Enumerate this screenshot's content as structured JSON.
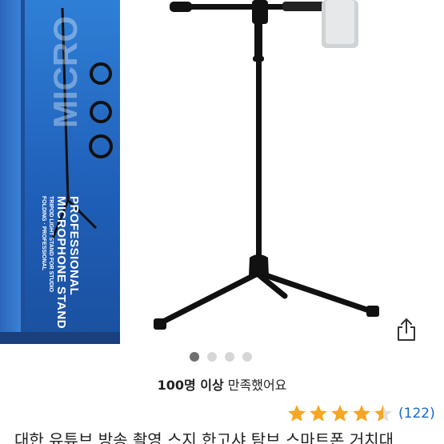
{
  "product_image": {
    "box_title_line1": "PROFESSIONAL",
    "box_title_line2": "MICROPHONE STAND",
    "box_subtitle_line1": "TRIPOD LIGHT STAND FOR STUDIO",
    "box_subtitle_line2": "FOLDING · PROFESSIONAL"
  },
  "carousel": {
    "page_count": 4,
    "active_index": 0
  },
  "share_icon": "share-icon",
  "satisfaction": {
    "highlight": "100명 이상",
    "rest": " 만족했어요"
  },
  "rating": {
    "value": 4.5,
    "max": 5,
    "star_color": "#f5a623",
    "count_text": "(122)"
  },
  "product_title": "대한 유튜브 방송 촬영 스지 한고샤 탐브 스마트폰 거치대"
}
